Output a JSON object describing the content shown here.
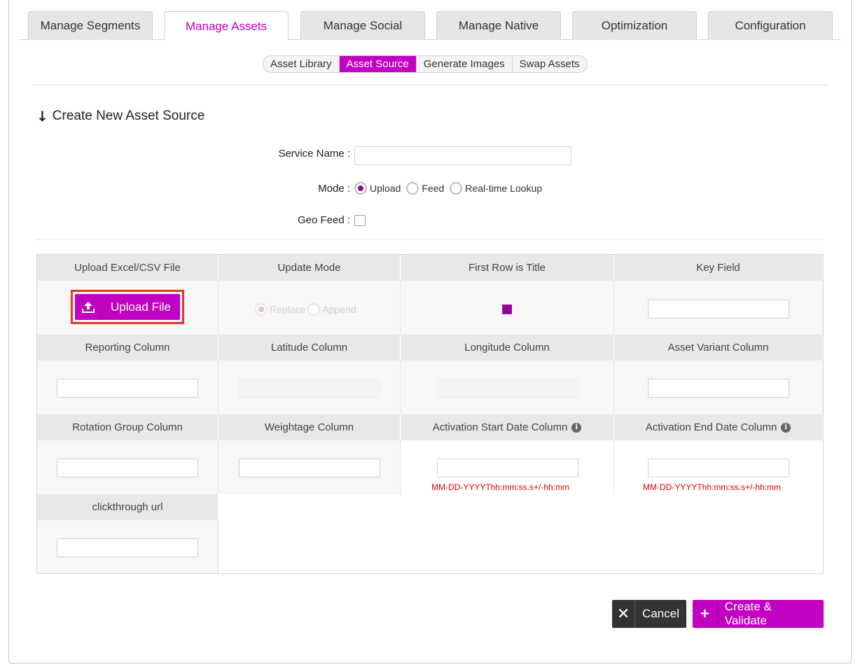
{
  "tabs": [
    {
      "label": "Manage Segments",
      "active": false
    },
    {
      "label": "Manage Assets",
      "active": true
    },
    {
      "label": "Manage Social",
      "active": false
    },
    {
      "label": "Manage Native",
      "active": false
    },
    {
      "label": "Optimization",
      "active": false
    },
    {
      "label": "Configuration",
      "active": false
    }
  ],
  "subtabs": [
    {
      "label": "Asset Library",
      "active": false
    },
    {
      "label": "Asset Source",
      "active": true
    },
    {
      "label": "Generate Images",
      "active": false
    },
    {
      "label": "Swap Assets",
      "active": false
    }
  ],
  "section_title": "Create New Asset Source",
  "form": {
    "service_name_label": "Service Name :",
    "service_name_value": "",
    "mode_label": "Mode :",
    "mode_options": [
      "Upload",
      "Feed",
      "Real-time Lookup"
    ],
    "mode_selected": "Upload",
    "geo_feed_label": "Geo Feed :",
    "geo_feed_checked": false
  },
  "grid": {
    "headers_row1": [
      "Upload Excel/CSV File",
      "Update Mode",
      "First Row is Title",
      "Key Field"
    ],
    "upload_button": "Upload File",
    "update_mode_options": [
      "Replace",
      "Append"
    ],
    "update_mode_selected": "Replace",
    "first_row_is_title": true,
    "headers_row2": [
      "Reporting Column",
      "Latitude Column",
      "Longitude Column",
      "Asset Variant Column"
    ],
    "headers_row3": [
      "Rotation Group Column",
      "Weightage Column",
      "Activation Start Date Column",
      "Activation End Date Column"
    ],
    "date_format_hint": "MM-DD-YYYYThh:mm:ss.s+/-hh:mm",
    "headers_row4": [
      "clickthrough url"
    ]
  },
  "buttons": {
    "cancel": "Cancel",
    "create": "Create & Validate"
  },
  "colors": {
    "accent": "#c200c2",
    "dark_button": "#333333",
    "hint_red": "#e00000"
  }
}
